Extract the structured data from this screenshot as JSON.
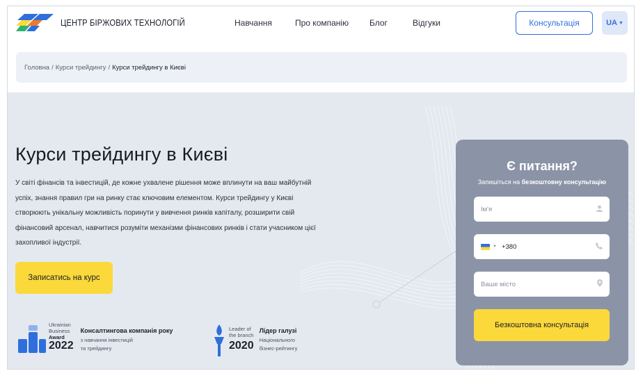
{
  "brand": {
    "name": "ЦЕНТР БІРЖОВИХ ТЕХНОЛОГІЙ",
    "colors": {
      "blue": "#2f6fdc",
      "yellow": "#fbd93b",
      "green": "#2fb36b",
      "orange": "#f07a2b"
    }
  },
  "nav": {
    "items": [
      {
        "label": "Навчання"
      },
      {
        "label": "Про компанію"
      },
      {
        "label": "Блог"
      },
      {
        "label": "Відгуки"
      }
    ],
    "consult_label": "Консультація",
    "lang_label": "UA"
  },
  "breadcrumb": {
    "home": "Головна",
    "parent": "Курси трейдингу",
    "current": "Курси трейдингу в Києві",
    "separator": "/"
  },
  "hero": {
    "title": "Курси трейдингу в Києві",
    "intro_lines": [
      "У світі фінансів та інвестицій, де кожне ухвалене рішення може вплинути на ваш майбутній",
      "успіх, знання правил гри на ринку стає ключовим елементом. Курси трейдингу у Києві",
      "створюють унікальну можливість поринути у вивчення ринків капіталу, розширити свій",
      "фінансовий арсенал, навчитися розуміти механізми фінансових ринків і стати учасником цієї",
      "захопливої індустрії."
    ],
    "enroll_label": "Записатись на курс"
  },
  "awards": [
    {
      "badge_lines": [
        "Ukrainian",
        "Business",
        "Award"
      ],
      "year": "2022",
      "title": "Консалтингова компанія року",
      "sub_lines": [
        "з навчання інвестицій",
        "та трейдингу"
      ]
    },
    {
      "badge_lines": [
        "Leader of",
        "the branch"
      ],
      "year": "2020",
      "title": "Лідер галузі",
      "sub_lines": [
        "Національного",
        "бізнес-рейтингу"
      ]
    }
  ],
  "form": {
    "title": "Є питання?",
    "subtitle_prefix": "Запишіться на",
    "subtitle_bold": "безкоштовну консультацію",
    "name_placeholder": "Ім'я",
    "phone_value": "+380",
    "city_placeholder": "Ваше місто",
    "submit_label": "Безкоштовна консультація",
    "icons": {
      "name": "user-icon",
      "phone": "phone-icon",
      "city": "location-pin-icon"
    }
  }
}
